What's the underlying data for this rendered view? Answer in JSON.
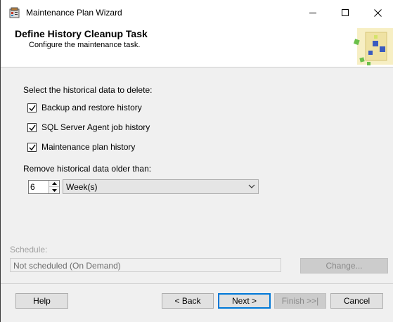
{
  "window": {
    "title": "Maintenance Plan Wizard"
  },
  "header": {
    "title": "Define History Cleanup Task",
    "subtitle": "Configure the maintenance task."
  },
  "form": {
    "select_label": "Select the historical data to delete:",
    "checkboxes": [
      {
        "label": "Backup and restore history",
        "checked": true
      },
      {
        "label": "SQL Server Agent job history",
        "checked": true
      },
      {
        "label": "Maintenance plan history",
        "checked": true
      }
    ],
    "older_than_label": "Remove historical data older than:",
    "age_value": "6",
    "unit_value": "Week(s)"
  },
  "schedule": {
    "label": "Schedule:",
    "value": "Not scheduled (On Demand)",
    "change_label": "Change..."
  },
  "buttons": {
    "help": "Help",
    "back": "< Back",
    "next": "Next >",
    "finish": "Finish >>|",
    "cancel": "Cancel"
  },
  "colors": {
    "accent": "#0078d7",
    "window_bg": "#f0f0f0",
    "disabled_text": "#8a8a8a"
  }
}
